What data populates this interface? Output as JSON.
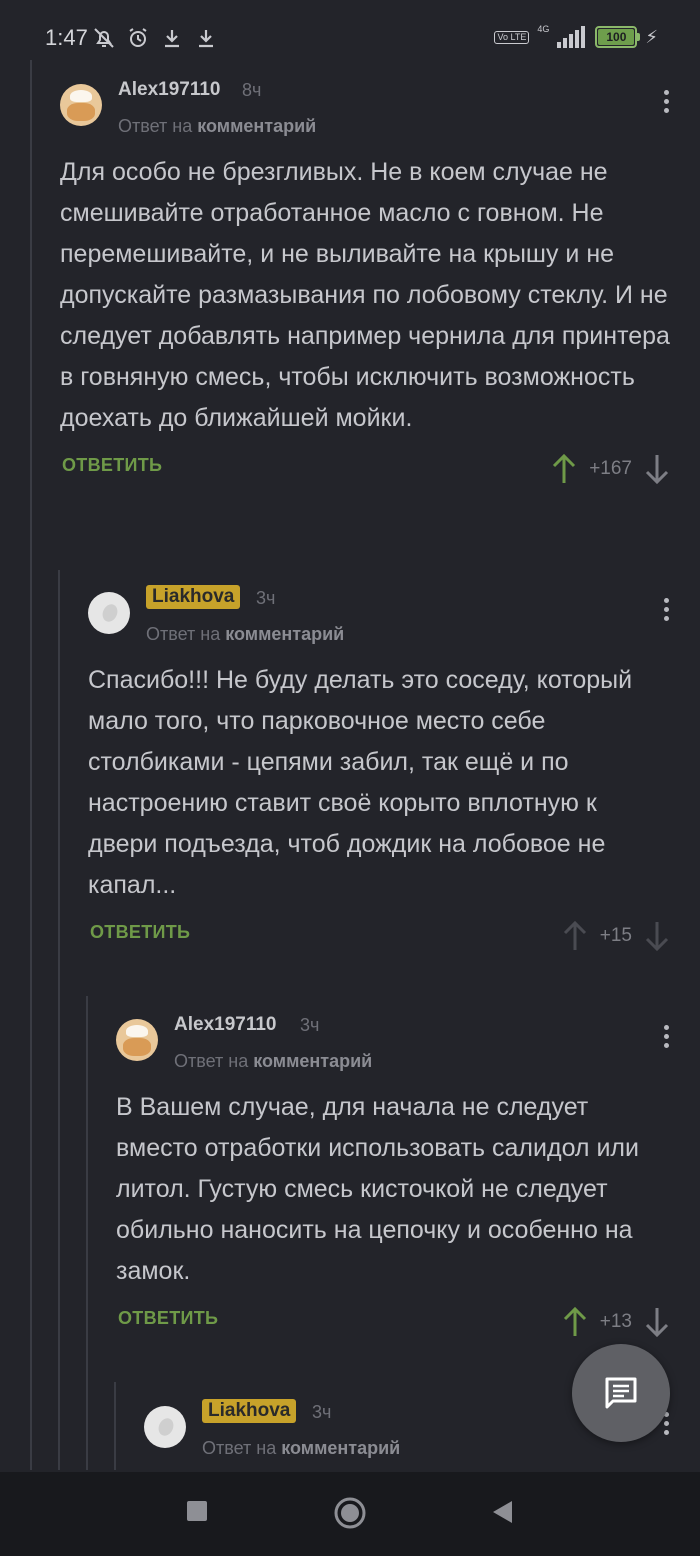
{
  "status_bar": {
    "time": "1:47",
    "volte": "Vo LTE",
    "network": "4G",
    "battery": "100",
    "battery_level": 1.0,
    "icons": [
      "mute-bell-icon",
      "alarm-icon",
      "download-icon",
      "download-icon",
      "signal-icon",
      "charging-icon"
    ]
  },
  "comments": [
    {
      "author": "Alex197110",
      "time": "8ч",
      "reply_prefix": "Ответ на",
      "reply_target": "комментарий",
      "text": "Для особо не брезгливых. Не в коем случае не смешивайте отработанное масло с говном. Не перемешивайте, и не выливайте на крышу и не допускайте размазывания по лобовому стеклу. И не следует добавлять например чернила для принтера в говняную смесь, чтобы исключить возможность доехать до ближайшей мойки.",
      "reply_label": "ОТВЕТИТЬ",
      "score": "+167",
      "upvote_color": "#6f9a48"
    },
    {
      "author": "Liakhova",
      "time": "3ч",
      "reply_prefix": "Ответ на",
      "reply_target": "комментарий",
      "text": "Спасибо!!! Не буду делать это соседу, который мало того, что парковочное место себе столбиками - цепями забил, так ещё и по настроению ставит своё корыто вплотную к двери подъезда, чтоб дождик на лобовое не капал...",
      "reply_label": "ОТВЕТИТЬ",
      "score": "+15",
      "upvote_color": "#4a4b52"
    },
    {
      "author": "Alex197110",
      "time": "3ч",
      "reply_prefix": "Ответ на",
      "reply_target": "комментарий",
      "text": "В Вашем случае, для начала не следует вместо отработки использовать салидол или литол. Густую смесь кисточкой не следует обильно наносить на цепочку и особенно на замок.",
      "reply_label": "ОТВЕТИТЬ",
      "score": "+13",
      "upvote_color": "#6f9a48"
    },
    {
      "author": "Liakhova",
      "time": "3ч",
      "reply_prefix": "Ответ на",
      "reply_target": "комментарий"
    }
  ],
  "colors": {
    "background": "#23242a",
    "accent_green": "#6f9a48",
    "badge": "#c7a22a"
  }
}
